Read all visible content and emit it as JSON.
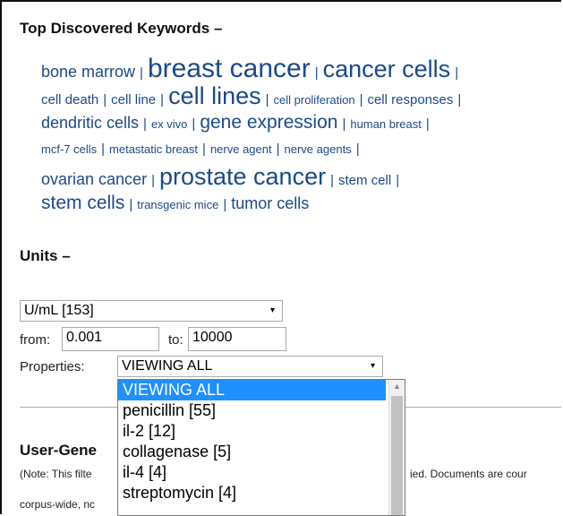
{
  "keywords_section": {
    "title": "Top Discovered Keywords –",
    "lines": [
      [
        {
          "text": "bone marrow",
          "size": 3
        },
        {
          "text": "breast cancer",
          "size": 6
        },
        {
          "text": "cancer cells",
          "size": 5
        }
      ],
      [
        {
          "text": "cell death",
          "size": 2
        },
        {
          "text": "cell line",
          "size": 2
        },
        {
          "text": "cell lines",
          "size": 5
        },
        {
          "text": "cell proliferation",
          "size": 1
        },
        {
          "text": "cell responses",
          "size": 2
        }
      ],
      [
        {
          "text": "dendritic cells",
          "size": 3
        },
        {
          "text": "ex vivo",
          "size": 1
        },
        {
          "text": "gene expression",
          "size": 4
        },
        {
          "text": "human breast",
          "size": 1
        }
      ],
      [
        {
          "text": "mcf-7 cells",
          "size": 1
        },
        {
          "text": "metastatic breast",
          "size": 1
        },
        {
          "text": "nerve agent",
          "size": 1
        },
        {
          "text": "nerve agents",
          "size": 1
        }
      ],
      [
        {
          "text": "ovarian cancer",
          "size": 3
        },
        {
          "text": "prostate cancer",
          "size": 5
        },
        {
          "text": "stem cell",
          "size": 2
        }
      ],
      [
        {
          "text": "stem cells",
          "size": 4
        },
        {
          "text": "transgenic mice",
          "size": 1
        },
        {
          "text": "tumor cells",
          "size": 3
        }
      ]
    ],
    "separator": "|"
  },
  "units_section": {
    "title": "Units –",
    "unit_select": {
      "value": "U/mL [153]",
      "arrow": "▾"
    },
    "from_label": "from:",
    "from_value": "0.001",
    "to_label": "to:",
    "to_value": "10000",
    "properties_label": "Properties:",
    "properties_select": {
      "value": "VIEWING ALL",
      "arrow": "▾"
    },
    "properties_options": [
      "VIEWING ALL",
      "penicillin [55]",
      "il-2 [12]",
      "collagenase [5]",
      "il-4 [4]",
      "streptomycin [4]"
    ]
  },
  "user_generated": {
    "title_visible": "User-Gene",
    "note_left_1": "(Note: This filte",
    "note_right_1": "ied. Documents are cour",
    "note_left_2": "corpus-wide, nc"
  },
  "colors": {
    "keyword_link": "#1a4a8a",
    "selected_option": "#1e90ff"
  },
  "icons": {
    "scroll_up": "chevron-up-icon",
    "select_arrow": "chevron-down-icon"
  }
}
